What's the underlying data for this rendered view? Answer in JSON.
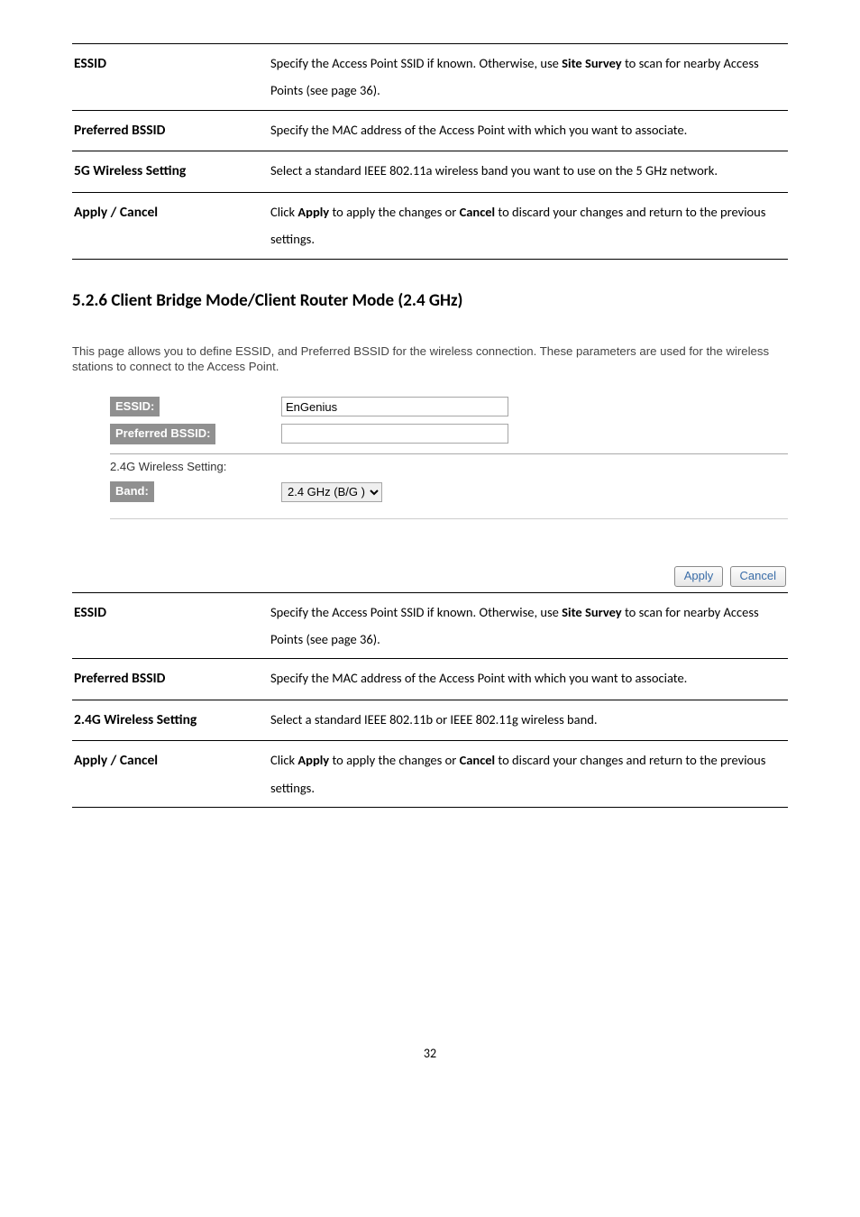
{
  "table1": {
    "rows": [
      {
        "term": "ESSID",
        "desc": "Specify the Access Point SSID if known. Otherwise, use <b>Site Survey</b> to scan for nearby Access Points (see page 36)."
      },
      {
        "term": "Preferred BSSID",
        "desc": "Specify the MAC address of the Access Point with which you want to associate."
      },
      {
        "term": "5G Wireless Setting",
        "desc": "Select a standard IEEE 802.11a wireless band you want to use on the 5 GHz network."
      },
      {
        "term": "Apply / Cancel",
        "desc": "Click <b>Apply</b> to apply the changes or <b>Cancel</b> to discard your changes and return to the previous settings."
      }
    ]
  },
  "section_heading": "5.2.6 Client Bridge Mode/Client Router Mode (2.4 GHz)",
  "intro": "This page allows you to define ESSID, and Preferred BSSID for the wireless connection. These parameters are used for the wireless stations to connect to the Access Point.",
  "form": {
    "essid_label": "ESSID:",
    "essid_value": "EnGenius",
    "bssid_label": "Preferred BSSID:",
    "bssid_value": "",
    "section_line": "2.4G Wireless Setting:",
    "band_label": "Band:",
    "band_value": "2.4 GHz (B/G )"
  },
  "buttons": {
    "apply": "Apply",
    "cancel": "Cancel"
  },
  "table2": {
    "rows": [
      {
        "term": "ESSID",
        "desc": "Specify the Access Point SSID if known. Otherwise, use <b>Site Survey</b> to scan for nearby Access Points (see page 36)."
      },
      {
        "term": "Preferred BSSID",
        "desc": "Specify the MAC address of the Access Point with which you want to associate."
      },
      {
        "term": "2.4G Wireless Setting",
        "desc": "Select a standard IEEE 802.11b or IEEE 802.11g wireless band."
      },
      {
        "term": "Apply / Cancel",
        "desc": "Click <b>Apply</b> to apply the changes or <b>Cancel</b> to discard your changes and return to the previous settings."
      }
    ]
  },
  "page_number": "32"
}
